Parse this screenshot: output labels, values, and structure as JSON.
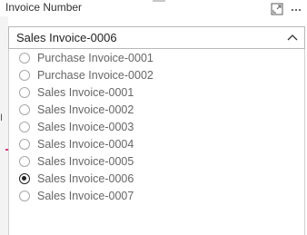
{
  "slicer": {
    "title": "Invoice Number",
    "focus_icon": "focus-mode-icon",
    "more_icon": "more-options-icon",
    "selected_value": "Sales Invoice-0006",
    "options": [
      {
        "label": "Purchase Invoice-0001",
        "selected": false
      },
      {
        "label": "Purchase Invoice-0002",
        "selected": false
      },
      {
        "label": "Sales Invoice-0001",
        "selected": false
      },
      {
        "label": "Sales Invoice-0002",
        "selected": false
      },
      {
        "label": "Sales Invoice-0003",
        "selected": false
      },
      {
        "label": "Sales Invoice-0004",
        "selected": false
      },
      {
        "label": "Sales Invoice-0005",
        "selected": false
      },
      {
        "label": "Sales Invoice-0006",
        "selected": true
      },
      {
        "label": "Sales Invoice-0007",
        "selected": false
      }
    ]
  },
  "background": {
    "fragment_text": "I",
    "accent_color": "#e0337a"
  }
}
